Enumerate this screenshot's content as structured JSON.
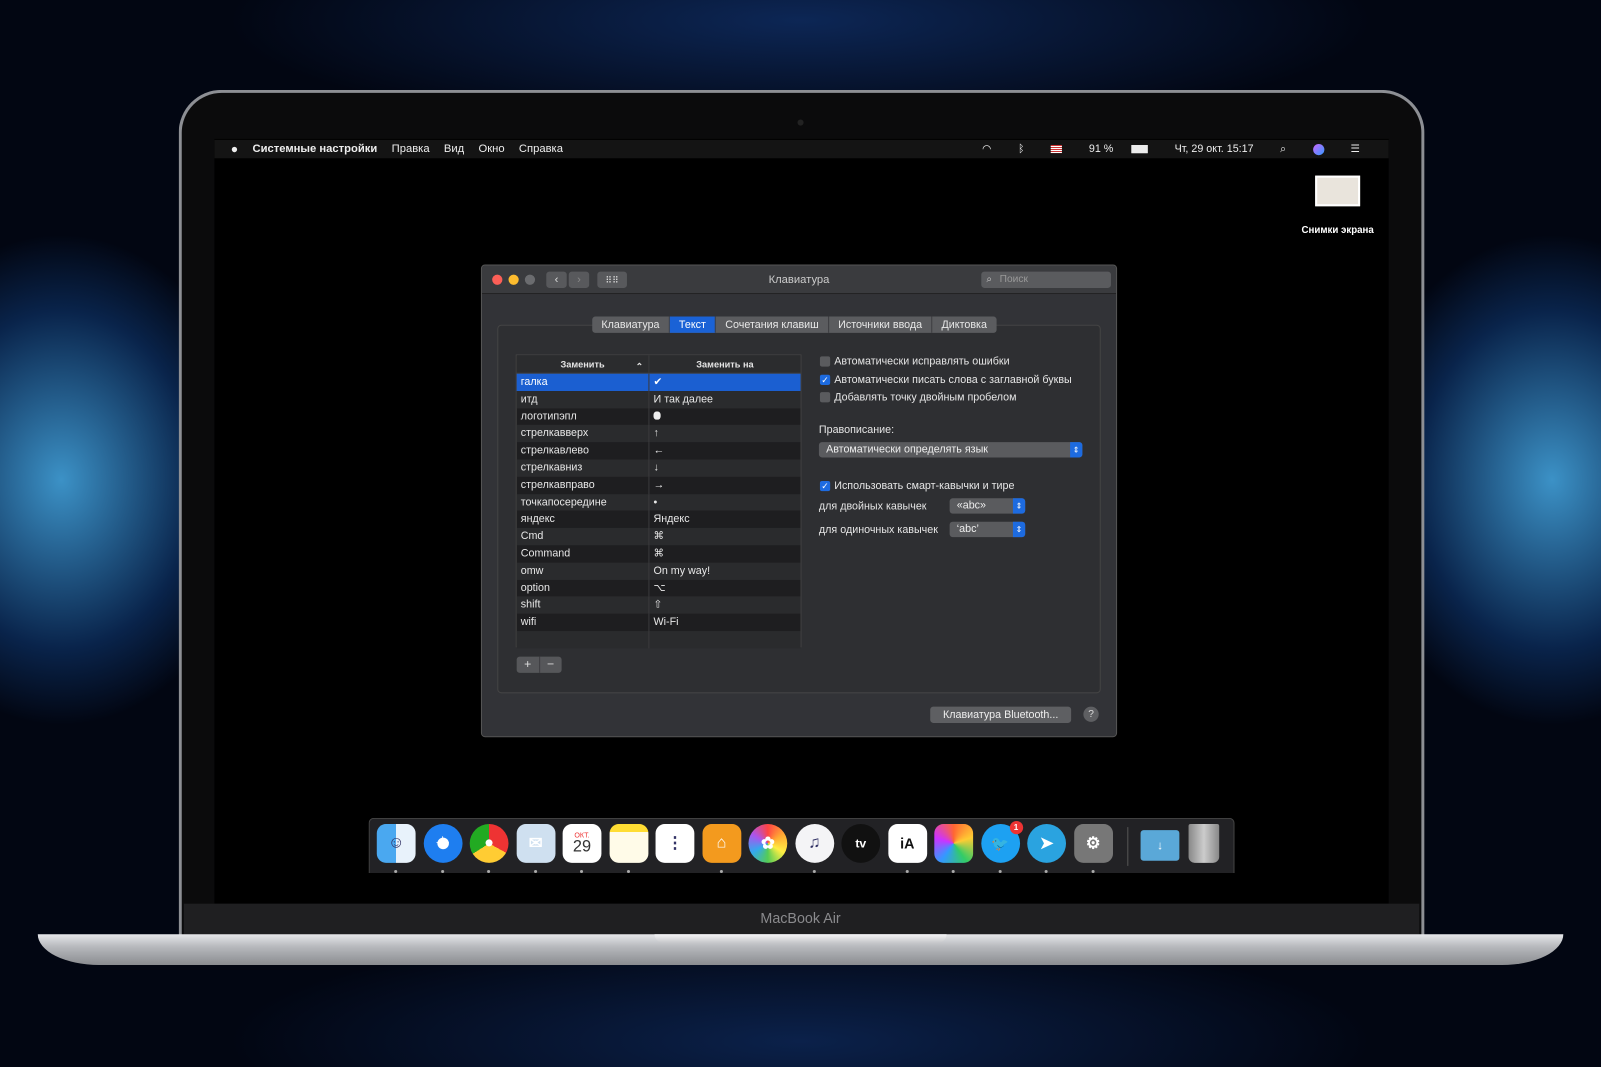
{
  "menubar": {
    "apple": "",
    "app": "Системные настройки",
    "items": [
      "Правка",
      "Вид",
      "Окно",
      "Справка"
    ],
    "battery": "91 %",
    "clock": "Чт, 29 окт.  15:17",
    "status_icons": [
      "wifi-icon",
      "bluetooth-icon",
      "us-flag-icon",
      "battery-icon",
      "search-icon",
      "siri-icon",
      "notification-list-icon"
    ]
  },
  "desktop": {
    "icon_label": "Снимки экрана"
  },
  "window": {
    "title": "Клавиатура",
    "search_placeholder": "Поиск",
    "tabs": [
      "Клавиатура",
      "Текст",
      "Сочетания клавиш",
      "Источники ввода",
      "Диктовка"
    ],
    "active_tab": 1,
    "table": {
      "headers": [
        "Заменить",
        "Заменить на"
      ],
      "sort_indicator": "⌃",
      "rows": [
        [
          "галка",
          "✔"
        ],
        [
          "итд",
          "И так далее"
        ],
        [
          "логотипэпл",
          ""
        ],
        [
          "стрелкавверх",
          "↑"
        ],
        [
          "стрелкавлево",
          "←"
        ],
        [
          "стрелкавниз",
          "↓"
        ],
        [
          "стрелкавправо",
          "→"
        ],
        [
          "точкапосередине",
          "•"
        ],
        [
          "яндекс",
          "Яндекс"
        ],
        [
          "Cmd",
          "⌘"
        ],
        [
          "Command",
          "⌘"
        ],
        [
          "omw",
          "On my way!"
        ],
        [
          "option",
          "⌥"
        ],
        [
          "shift",
          "⇧"
        ],
        [
          "wifi",
          "Wi-Fi"
        ]
      ],
      "selected_row": 0
    },
    "add": "+",
    "remove": "−",
    "options": [
      {
        "label": "Автоматически исправлять ошибки",
        "checked": false
      },
      {
        "label": "Автоматически писать слова с заглавной буквы",
        "checked": true
      },
      {
        "label": "Добавлять точку двойным пробелом",
        "checked": false
      }
    ],
    "spelling_label": "Правописание:",
    "spelling_value": "Автоматически определять язык",
    "smart_quotes": {
      "label": "Использовать смарт-кавычки и тире",
      "checked": true
    },
    "double_label": "для двойных кавычек",
    "double_value": "«abc»",
    "single_label": "для одиночных кавычек",
    "single_value": "‘abc’",
    "bluetooth_button": "Клавиатура Bluetooth...",
    "help": "?"
  },
  "dock": {
    "apps": [
      "finder",
      "safari",
      "chrome",
      "mail",
      "calendar",
      "notes",
      "reminders",
      "home",
      "photos",
      "music",
      "apple-tv",
      "ia-writer",
      "pixelmator",
      "twitter",
      "telegram",
      "system-preferences"
    ],
    "calendar_month": "ОКТ.",
    "calendar_day": "29",
    "tv_label": "tv",
    "ia_label": "iA",
    "twitter_badge": "1",
    "folders": [
      "downloads",
      "trash"
    ]
  },
  "device": {
    "name": "MacBook Air"
  },
  "colors": {
    "accent": "#1b5fd1"
  }
}
